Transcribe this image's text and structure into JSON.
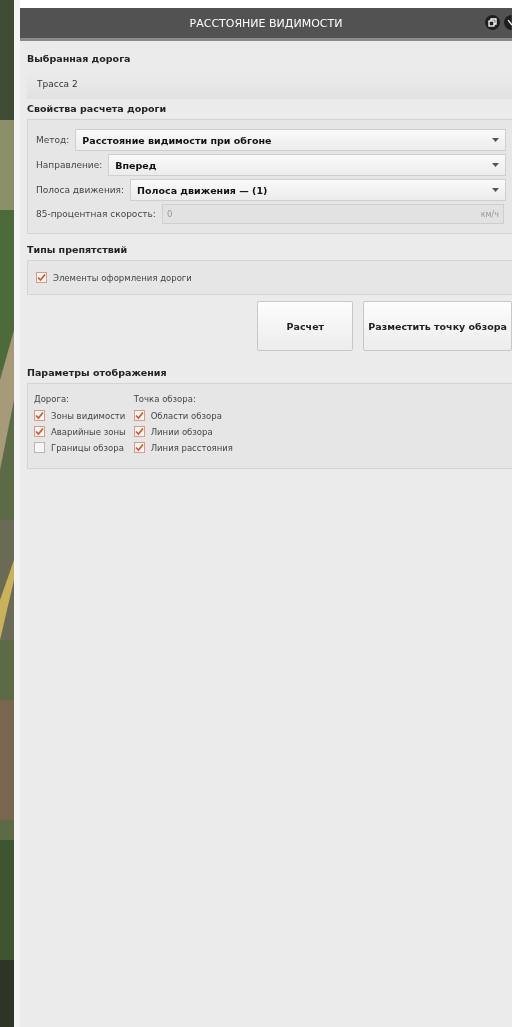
{
  "window": {
    "title": "РАССТОЯНИЕ ВИДИМОСТИ"
  },
  "selected_road": {
    "heading": "Выбранная дорога",
    "value": "Трасса 2"
  },
  "road_properties": {
    "heading": "Свойства расчета дороги",
    "fields": [
      {
        "kind": "combo",
        "label": "Метод:",
        "value": "Расстояние видимости при обгоне"
      },
      {
        "kind": "combo",
        "label": "Направление:",
        "value": "Вперед"
      },
      {
        "kind": "combo",
        "label": "Полоса движения:",
        "value": "Полоса движения — (1)"
      },
      {
        "kind": "input",
        "label": "85-процентная скорость:",
        "value": "0",
        "unit": "км/ч",
        "disabled": true
      }
    ]
  },
  "obstacle_types": {
    "heading": "Типы препятствий",
    "options": [
      {
        "label": "Элементы оформления дороги",
        "checked": true
      }
    ]
  },
  "buttons": [
    "Расчет",
    "Разместить точку обзора"
  ],
  "display_params": {
    "heading": "Параметры отображения",
    "columns": [
      {
        "title": "Дорога:",
        "options": [
          {
            "label": "Зоны видимости",
            "checked": true
          },
          {
            "label": "Аварийные зоны",
            "checked": true
          },
          {
            "label": "Границы обзора",
            "checked": false
          }
        ]
      },
      {
        "title": "Точка обзора:",
        "options": [
          {
            "label": "Области обзора",
            "checked": true
          },
          {
            "label": "Линии обзора",
            "checked": true
          },
          {
            "label": "Линия расстояния",
            "checked": true
          }
        ]
      }
    ]
  }
}
